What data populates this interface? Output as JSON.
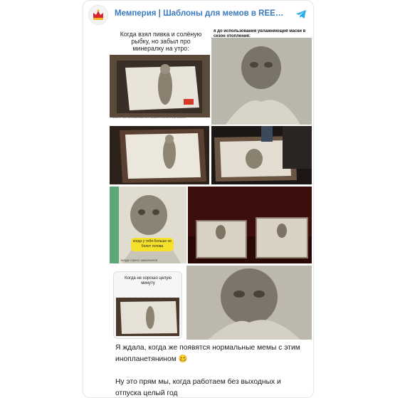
{
  "channel": {
    "title": "Мемперия | Шаблоны для мемов в REELS и не то...",
    "avatar_icon": "crown-icon",
    "source_icon": "telegram-icon",
    "accent_color": "#3a7bbf",
    "telegram_color": "#2aabee"
  },
  "media": {
    "meme1_caption": "Когда взял пивка и солёную рыбку, но забыл про минералку на утро:",
    "meme1_footer": "Новости. Тело инопланетянина было найдено в Мексике в ходе раскопок...",
    "meme2_caption": "я до использования увлажняющей маски в сезон отопления:",
    "meme5_sticker": "когда у тебя больше не болит голова",
    "meme5_note": "когда стресс закончился",
    "meme7_caption": "Когда не хорошо целую минуту"
  },
  "post": {
    "line1": "Я ждала, когда же появятся нормальные мемы с этим инопланетянином 🥴",
    "line2": "Ну это прям мы, когда работаем без выходных и отпуска целый год"
  }
}
